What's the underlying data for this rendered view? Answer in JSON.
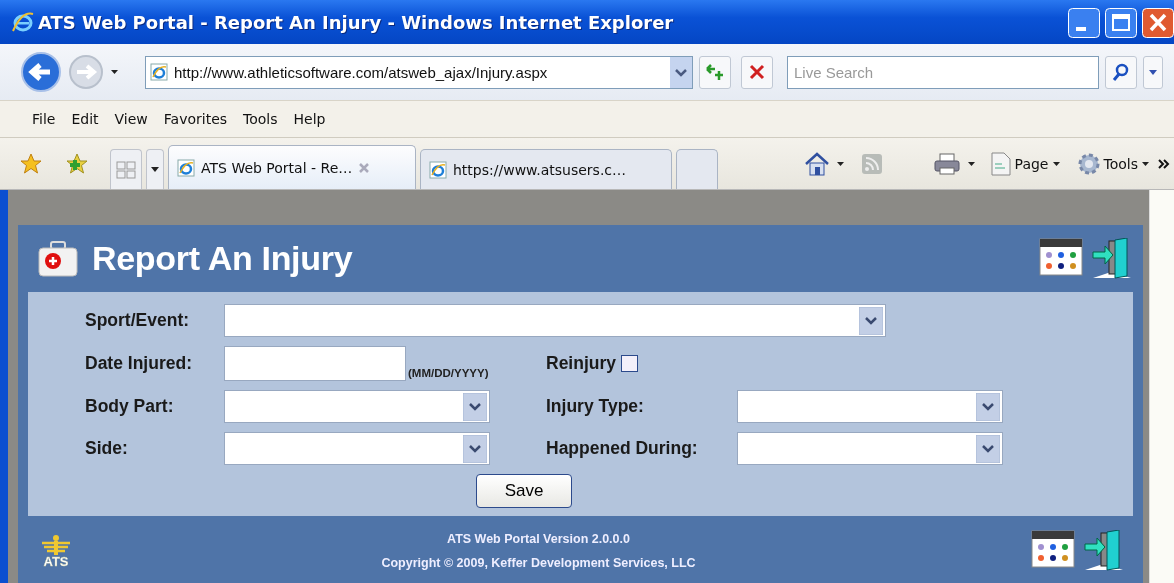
{
  "window": {
    "title": "ATS Web Portal - Report An Injury - Windows Internet Explorer"
  },
  "address_bar": {
    "value": "http://www.athleticsoftware.com/atsweb_ajax/Injury.aspx"
  },
  "search": {
    "placeholder": "Live Search"
  },
  "menu": [
    "File",
    "Edit",
    "View",
    "Favorites",
    "Tools",
    "Help"
  ],
  "tabs": [
    {
      "label": "ATS Web Portal - Re…",
      "selected": true
    },
    {
      "label": "https://www.atsusers.c…",
      "selected": false
    }
  ],
  "command_bar": [
    "Page",
    "Tools"
  ],
  "page": {
    "title": "Report An Injury",
    "fields": [
      {
        "kind": "select",
        "label": "Sport/Event:"
      },
      {
        "kind": "date",
        "label": "Date Injured:",
        "hint": "(MM/DD/YYYY)"
      },
      {
        "kind": "checkbox",
        "label": "Reinjury",
        "checked": false
      },
      {
        "kind": "select",
        "label": "Body Part:"
      },
      {
        "kind": "select",
        "label": "Injury Type:"
      },
      {
        "kind": "select",
        "label": "Side:"
      },
      {
        "kind": "select",
        "label": "Happened During:"
      }
    ],
    "save_button": "Save",
    "footer": {
      "logo_text": "ATS",
      "version": "ATS Web Portal Version 2.0.0.0",
      "copyright": "Copyright © 2009, Keffer Development Services, LLC"
    }
  }
}
